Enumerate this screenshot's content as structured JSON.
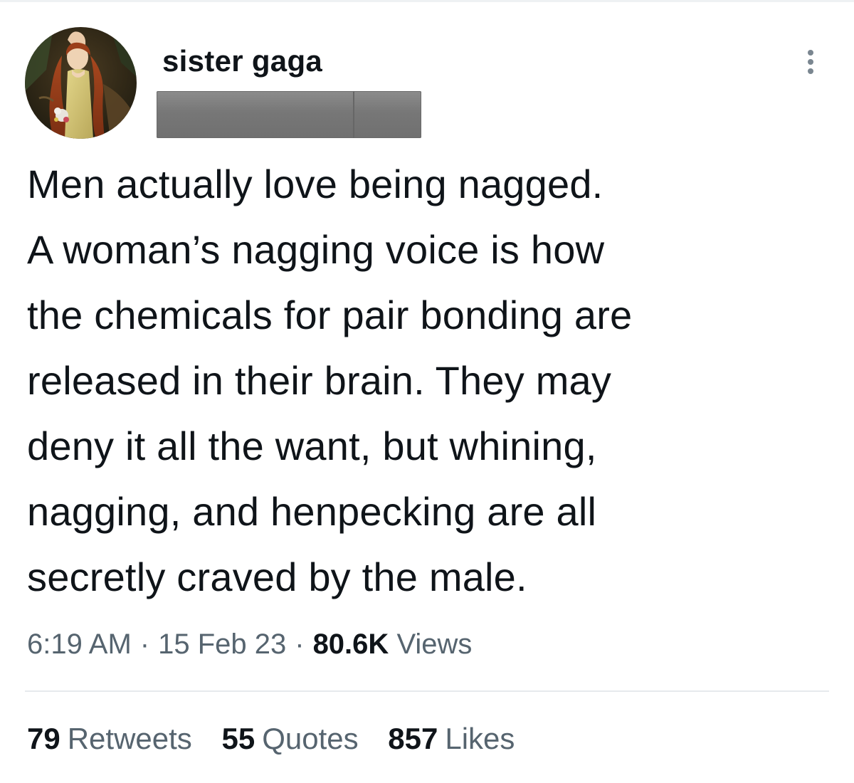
{
  "tweet": {
    "author": {
      "display_name": "sister gaga",
      "handle_redacted": true
    },
    "text_lines": [
      "Men actually love being nagged.",
      "A woman’s nagging voice is how",
      "the chemicals for pair bonding are",
      "released in their brain. They may",
      "deny it all the want, but whining,",
      "nagging, and henpecking are all",
      "secretly craved by the male."
    ],
    "meta": {
      "time": "6:19 AM",
      "separator": "·",
      "date": "15 Feb 23",
      "views_count": "80.6K",
      "views_label": "Views"
    },
    "stats": {
      "retweets": {
        "count": "79",
        "label": "Retweets"
      },
      "quotes": {
        "count": "55",
        "label": "Quotes"
      },
      "likes": {
        "count": "857",
        "label": "Likes"
      }
    },
    "icons": {
      "more": "more-vertical-icon",
      "avatar": "avatar-painting"
    }
  }
}
